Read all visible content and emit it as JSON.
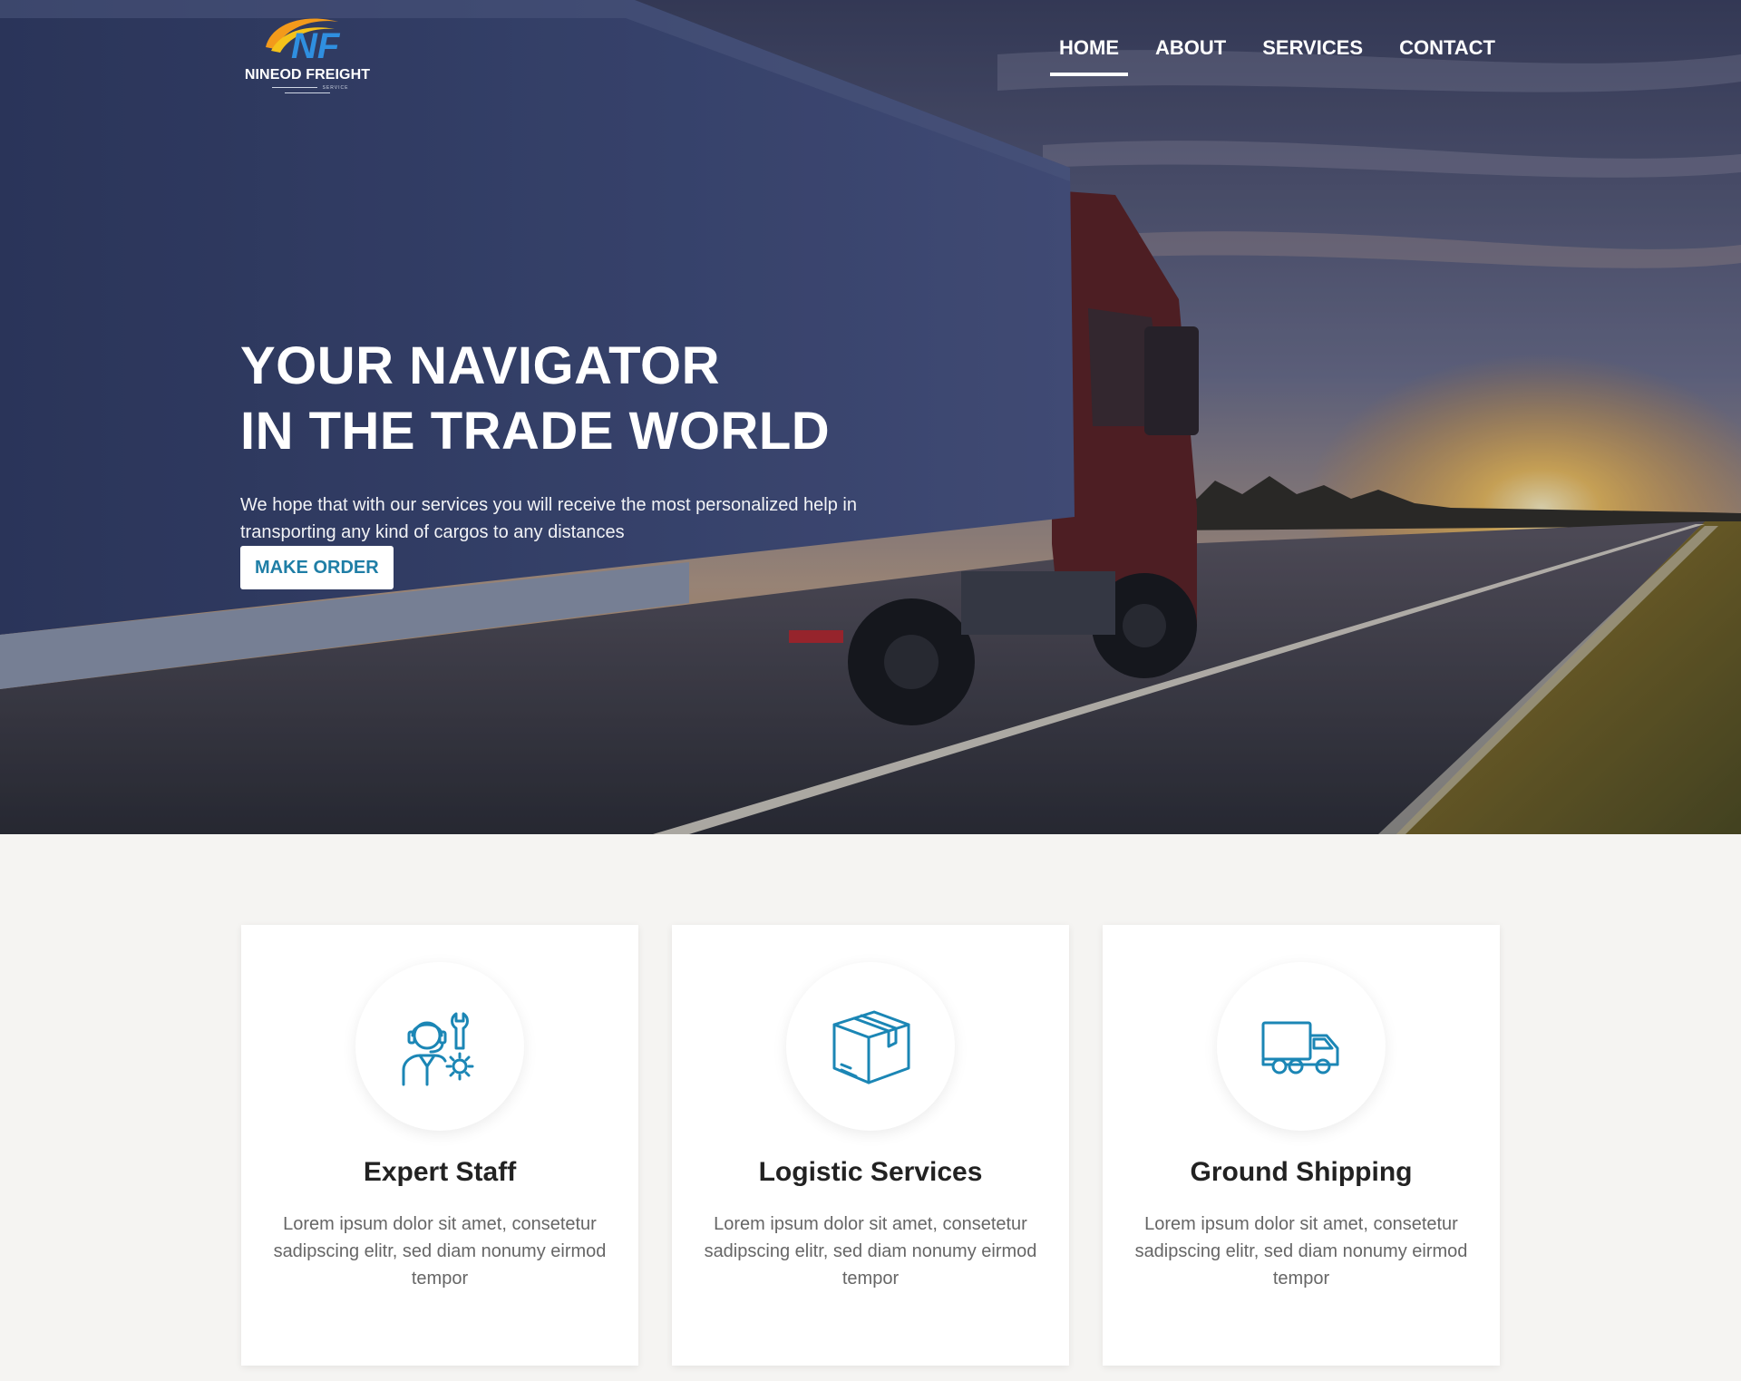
{
  "brand": {
    "name": "NINEOD FREIGHT",
    "tagline": "SERVICE",
    "mark_letters": "NF"
  },
  "nav": {
    "items": [
      {
        "label": "HOME",
        "active": true
      },
      {
        "label": "ABOUT",
        "active": false
      },
      {
        "label": "SERVICES",
        "active": false
      },
      {
        "label": "CONTACT",
        "active": false
      }
    ]
  },
  "hero": {
    "title_line1": "YOUR NAVIGATOR",
    "title_line2": "IN THE TRADE WORLD",
    "description": "We hope that with our services you will receive the most personalized help in transporting any kind of cargos to any distances",
    "cta_label": "MAKE ORDER"
  },
  "services": [
    {
      "icon": "support-staff-icon",
      "title": "Expert Staff",
      "text": "Lorem ipsum dolor sit amet, consetetur sadipscing elitr, sed diam nonumy eirmod tempor"
    },
    {
      "icon": "package-box-icon",
      "title": "Logistic Services",
      "text": "Lorem ipsum dolor sit amet, consetetur sadipscing elitr, sed diam nonumy eirmod tempor"
    },
    {
      "icon": "delivery-truck-icon",
      "title": "Ground Shipping",
      "text": "Lorem ipsum dolor sit amet, consetetur sadipscing elitr, sed diam nonumy eirmod tempor"
    }
  ],
  "colors": {
    "accent": "#1f7ea6",
    "icon_stroke": "#1b86b5",
    "page_background": "#f5f4f2",
    "card_background": "#ffffff"
  }
}
